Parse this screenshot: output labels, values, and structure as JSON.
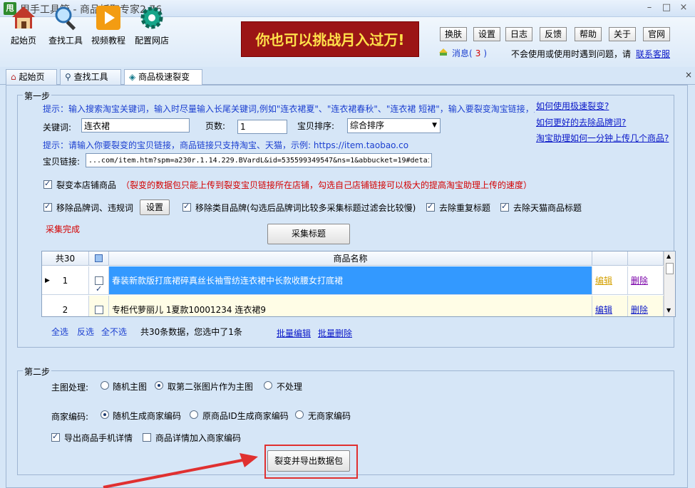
{
  "window": {
    "title": "甩手工具箱 - 商品抓取专家2.76",
    "logo": "甩",
    "min": "–",
    "max": "□",
    "close": "×"
  },
  "toolbar": {
    "items": [
      {
        "label": "起始页",
        "icon": "home-icon"
      },
      {
        "label": "查找工具",
        "icon": "magnifier-icon"
      },
      {
        "label": "视频教程",
        "icon": "play-icon"
      },
      {
        "label": "配置网店",
        "icon": "gear-icon"
      }
    ],
    "banner": "你也可以挑战月入过万!",
    "buttons": [
      "换肤",
      "设置",
      "日志",
      "反馈",
      "帮助",
      "关于",
      "官网"
    ],
    "msg_label": "消息(",
    "msg_count": "3",
    "msg_close": ")",
    "help_text": "不会使用或使用时遇到问题，请",
    "contact_link": "联系客服"
  },
  "tabs": [
    {
      "label": "起始页",
      "icon": "home-icon"
    },
    {
      "label": "查找工具",
      "icon": "search-icon"
    },
    {
      "label": "商品极速裂变",
      "icon": "fission-icon",
      "active": true
    }
  ],
  "tab_close": "×",
  "step1": {
    "legend": "第一步",
    "hint1": "提示：输入搜索淘宝关键词，输入时尽量输入长尾关键词,例如\"连衣裙夏\"、\"连衣裙春秋\"、\"连衣裙 短裙\"，输入要裂变淘宝链接，点击采集标题",
    "keyword_label": "关键词:",
    "keyword_value": "连衣裙",
    "pages_label": "页数:",
    "pages_value": "1",
    "sort_label": "宝贝排序:",
    "sort_value": "综合排序",
    "hint2": "提示：请输入你要裂变的宝贝链接，商品链接只支持淘宝、天猫，示例: https://item.taobao.co",
    "link_label": "宝贝链接:",
    "link_value": "...com/item.htm?spm=a230r.1.14.229.BVardL&id=535599349547&ns=1&abbucket=19#detail",
    "help_links": [
      "如何使用极速裂变?",
      "如何更好的去除品牌词?",
      "淘宝助理如何一分钟上传几个商品?"
    ],
    "opt_same_store": "裂变本店铺商品",
    "opt_same_store_note": "（裂变的数据包只能上传到裂变宝贝链接所在店铺，勾选自己店铺链接可以极大的提高淘宝助理上传的速度）",
    "opt_remove_brand": "移除品牌词、违规词",
    "settings_btn": "设置",
    "opt_remove_cat_brand": "移除类目品牌(勾选后品牌词比较多采集标题过滤会比较慢)",
    "opt_dedupe": "去除重复标题",
    "opt_tmall": "去除天猫商品标题",
    "status": "采集完成",
    "collect_btn": "采集标题",
    "grid": {
      "count_header": "共30",
      "name_header": "商品名称",
      "rows": [
        {
          "no": "1",
          "name": "春装新款版打底裙碎真丝长袖雪纺连衣裙中长款收腰女打底裙",
          "edit": "编辑",
          "del": "删除",
          "checked": true,
          "selected": true
        },
        {
          "no": "2",
          "name": "专柜代萝丽儿 1夏款10001234 连衣裙9",
          "edit": "编辑",
          "del": "删除",
          "checked": false,
          "selected": false
        }
      ]
    },
    "select_all": "全选",
    "invert": "反选",
    "select_none": "全不选",
    "summary": "共30条数据，您选中了1条",
    "batch_edit": "批量编辑",
    "batch_delete": "批量删除"
  },
  "step2": {
    "legend": "第二步",
    "main_img_label": "主图处理:",
    "main_img_opts": [
      "随机主图",
      "取第二张图片作为主图",
      "不处理"
    ],
    "main_img_selected": 1,
    "code_label": "商家编码:",
    "code_opts": [
      "随机生成商家编码",
      "原商品ID生成商家编码",
      "无商家编码"
    ],
    "code_selected": 0,
    "export_mobile": "导出商品手机详情",
    "add_code_detail": "商品详情加入商家编码",
    "export_btn": "裂变并导出数据包"
  },
  "colors": {
    "highlight": "#e03030",
    "selected_row": "#3399ff",
    "alt_row": "#fffde6"
  }
}
